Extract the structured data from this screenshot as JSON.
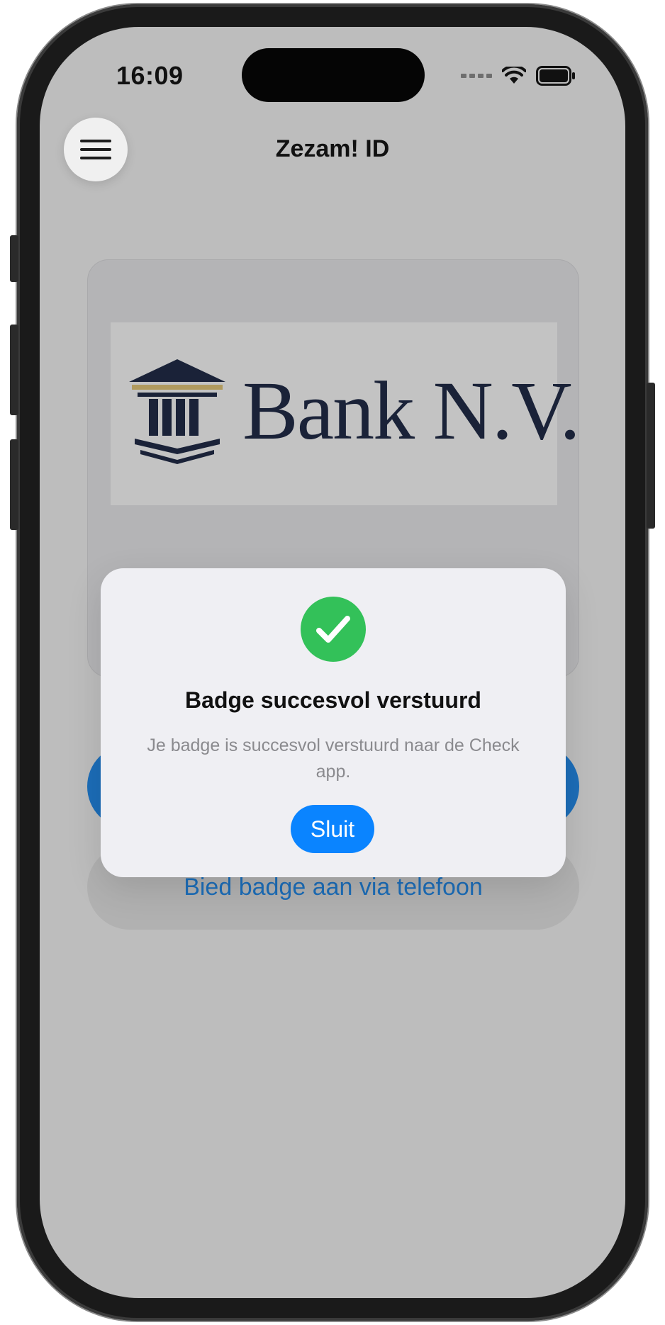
{
  "status_bar": {
    "time": "16:09"
  },
  "header": {
    "title": "Zezam! ID"
  },
  "card": {
    "logo_text": "Bank N.V."
  },
  "actions": {
    "secondary_label": "Bied badge aan via telefoon"
  },
  "dialog": {
    "title": "Badge succesvol verstuurd",
    "message": "Je badge is succesvol verstuurd naar de Check app.",
    "close_label": "Sluit"
  },
  "icons": {
    "menu": "hamburger-icon",
    "success": "checkmark-icon",
    "wifi": "wifi-icon",
    "battery": "battery-icon",
    "signal": "signal-icon",
    "logo": "bank-building-icon"
  },
  "colors": {
    "accent": "#0a84ff",
    "success": "#33c159",
    "link": "#1c6db8",
    "logo_navy": "#1a2238",
    "logo_gold": "#b09a5e"
  }
}
